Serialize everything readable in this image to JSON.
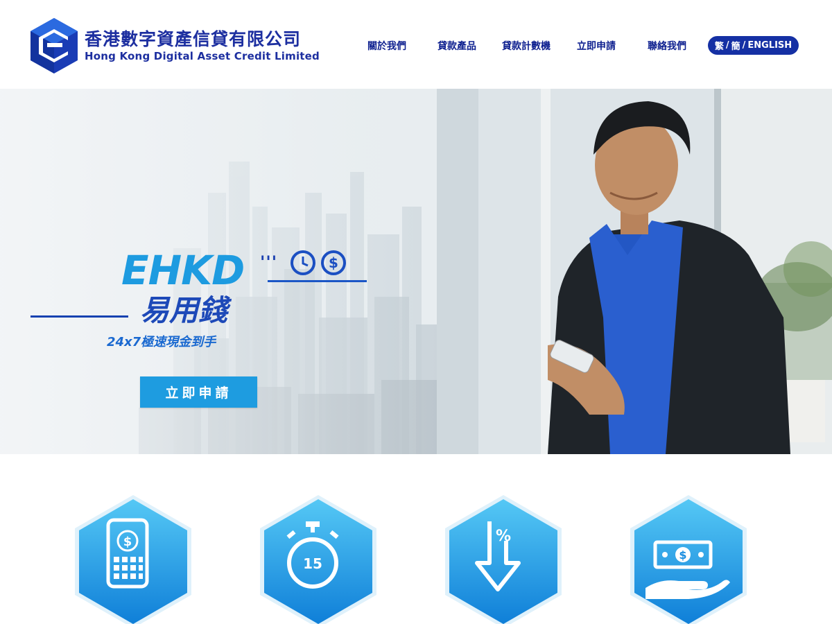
{
  "company": {
    "name_zh": "香港數字資產信貸有限公司",
    "name_en": "Hong Kong Digital Asset Credit Limited"
  },
  "nav": {
    "items": [
      {
        "label": "關於我們"
      },
      {
        "label": "貸款產品"
      },
      {
        "label": "貸款計數機"
      },
      {
        "label": "立即申請"
      },
      {
        "label": "聯絡我們"
      }
    ],
    "lang": {
      "trad": "繁",
      "sep1": "/",
      "simp": "簡",
      "sep2": "/",
      "en": "ENGLISH"
    }
  },
  "hero": {
    "brand": "EHKD",
    "brand_dots": "'''",
    "tagline_zh": "易用錢",
    "subtagline": "24x7極速現金到手",
    "apply_label": "立即申請"
  },
  "features": {
    "icons": [
      {
        "icon": "phone-dollar-icon"
      },
      {
        "icon": "stopwatch-15-icon",
        "value": "15"
      },
      {
        "icon": "rate-down-icon",
        "value": "%"
      },
      {
        "icon": "hand-money-icon",
        "value": "$"
      }
    ]
  },
  "colors": {
    "brand_blue": "#1d2fa0",
    "accent_blue": "#1e9ce0",
    "nav_pill": "#1530a4"
  }
}
